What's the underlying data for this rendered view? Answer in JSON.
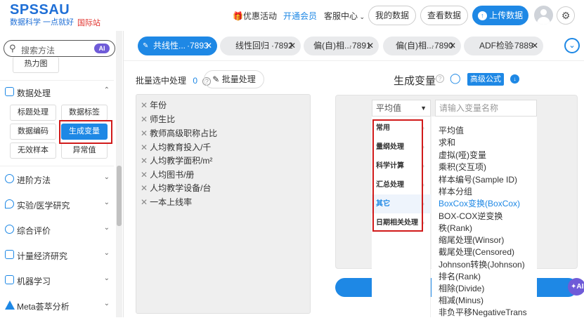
{
  "header": {
    "brand": "SPSSAU",
    "slogan": "数据科学 一点就好",
    "intl": "国际站",
    "promo": "优惠活动",
    "vip": "开通会员",
    "service": "客服中心",
    "my_data": "我的数据",
    "view_data": "查看数据",
    "upload": "上传数据"
  },
  "sidebar": {
    "search_placeholder": "搜索方法",
    "ai_badge": "AI",
    "heatmap": "热力图",
    "section_data": "数据处理",
    "chips": [
      "标题处理",
      "数据标签",
      "数据编码",
      "生成变量",
      "无效样本",
      "异常值"
    ],
    "sections": [
      "进阶方法",
      "实验/医学研究",
      "综合评价",
      "计量经济研究",
      "机器学习",
      "Meta荟萃分析"
    ]
  },
  "tabs": [
    {
      "label": "共线性...",
      "id": "·7893"
    },
    {
      "label": "线性回归",
      "id": "·7892"
    },
    {
      "label": "偏(自)相...",
      "id": "·7891"
    },
    {
      "label": "偏(自)相...",
      "id": "·7890"
    },
    {
      "label": "ADF检验",
      "id": "·7889"
    }
  ],
  "main": {
    "batch_label": "批量选中处理",
    "batch_count": "0",
    "batch_button": "批量处理",
    "title": "生成变量",
    "advanced": "高级公式",
    "variables": [
      "年份",
      "师生比",
      "教师高级职称占比",
      "人均教育投入/千",
      "人均教学面积/m²",
      "人均图书/册",
      "人均教学设备/台",
      "一本上线率"
    ],
    "select_value": "平均值",
    "name_placeholder": "请输入变量名称",
    "categories": [
      "常用",
      "量纲处理",
      "科学计算",
      "汇总处理",
      "其它",
      "日期相关处理"
    ],
    "selected_category": "其它",
    "options": [
      "平均值",
      "求和",
      "虚拟(哑)变量",
      "乘积(交互项)",
      "样本编号(Sample ID)",
      "样本分组",
      "BoxCox变换(BoxCox)",
      "BOX-COX逆变换",
      "秩(Rank)",
      "缩尾处理(Winsor)",
      "截尾处理(Censored)",
      "Johnson转换(Johnson)",
      "排名(Rank)",
      "相除(Divide)",
      "相减(Minus)",
      "非负平移NegativeTrans"
    ],
    "selected_option": "BoxCox变换(BoxCox)",
    "ai_float": "AI"
  },
  "colors": {
    "accent": "#1e88e5",
    "highlight": "#d11a1a",
    "ai": "#6f5bd8"
  }
}
